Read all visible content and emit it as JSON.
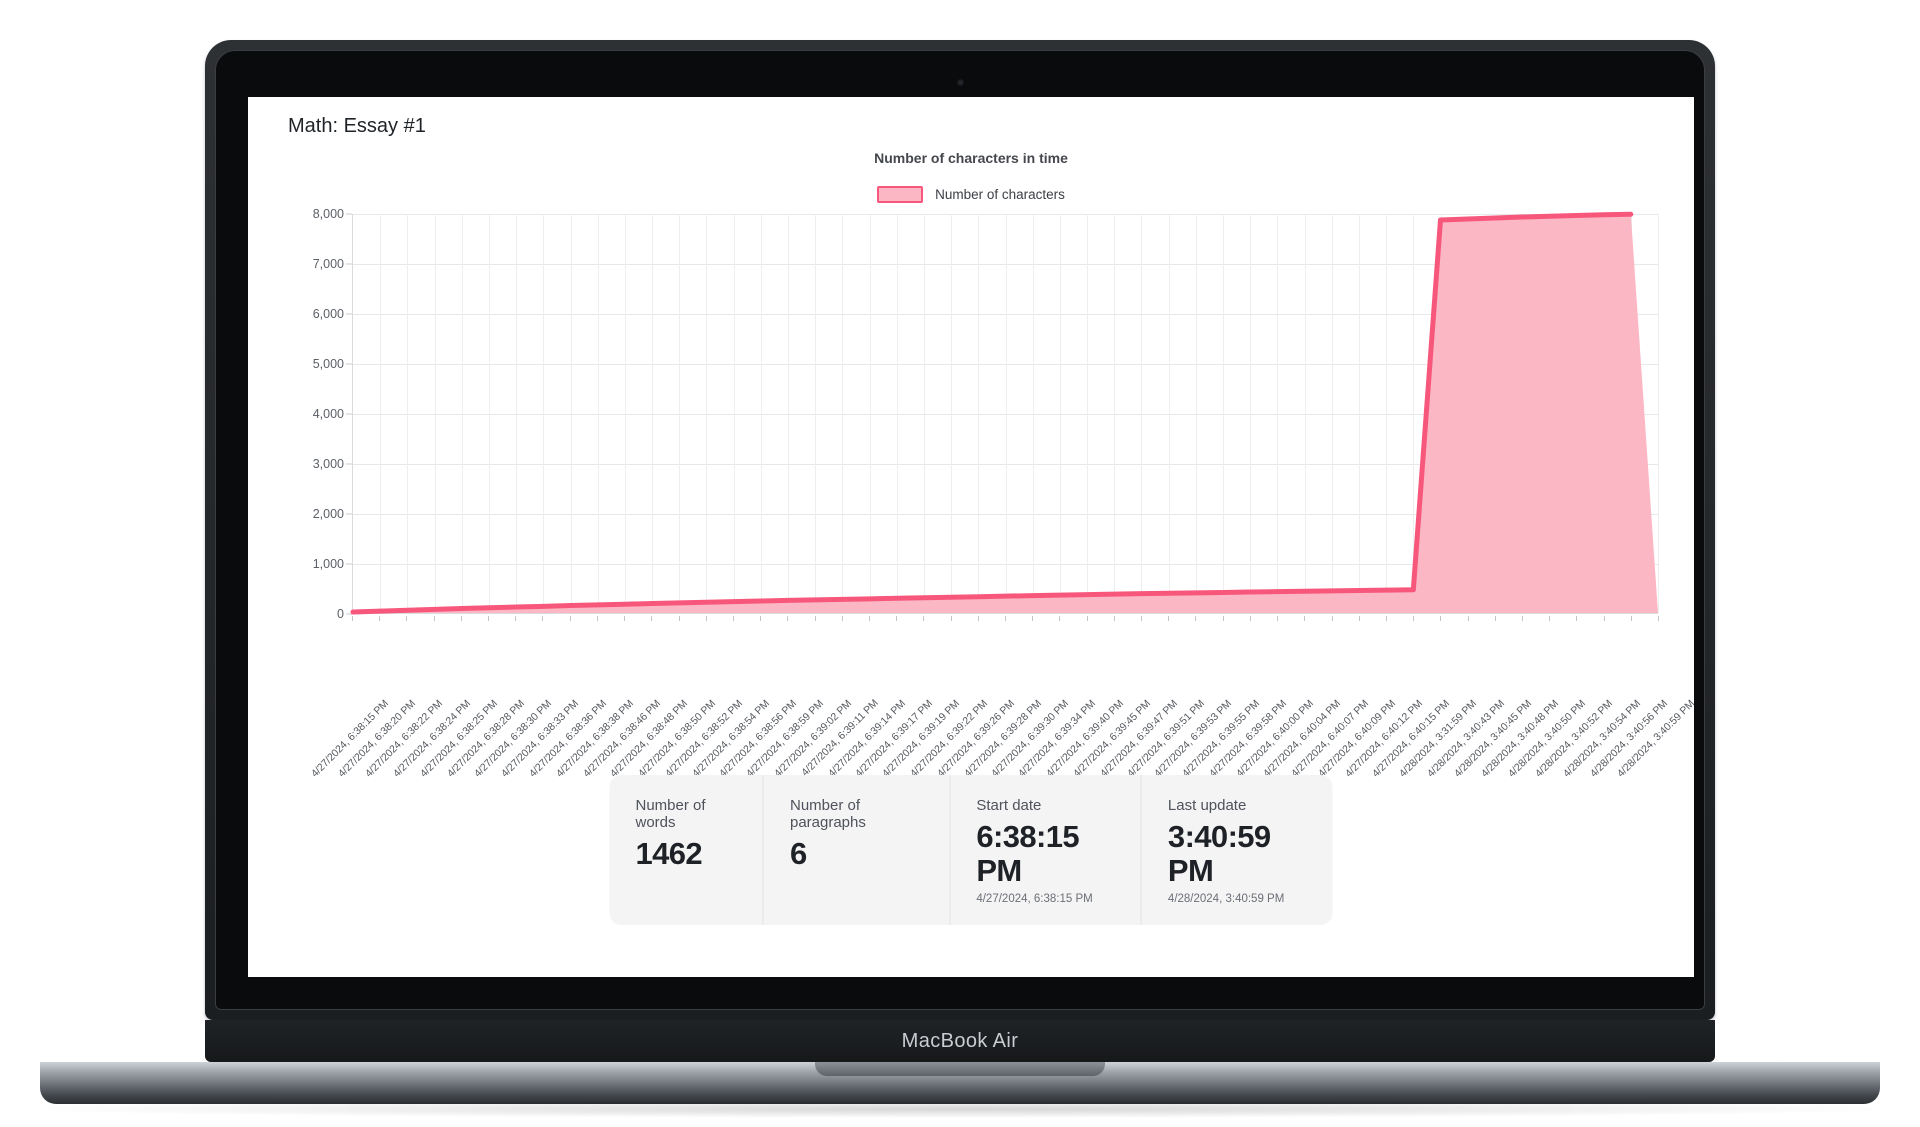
{
  "device": {
    "brand": "MacBook Air"
  },
  "page": {
    "title": "Math: Essay #1"
  },
  "chart_header": {
    "title": "Number of characters in time",
    "legend_label": "Number of characters",
    "line_color": "#f8577c",
    "fill_color": "#fbb7c4"
  },
  "stats": [
    {
      "label": "Number of words",
      "value": "1462",
      "sub": ""
    },
    {
      "label": "Number of paragraphs",
      "value": "6",
      "sub": ""
    },
    {
      "label": "Start date",
      "value": "6:38:15 PM",
      "sub": "4/27/2024, 6:38:15 PM"
    },
    {
      "label": "Last update",
      "value": "3:40:59 PM",
      "sub": "4/28/2024, 3:40:59 PM"
    }
  ],
  "chart_data": {
    "type": "area",
    "title": "Number of characters in time",
    "xlabel": "",
    "ylabel": "",
    "ylim": [
      0,
      8000
    ],
    "y_ticks": [
      "0",
      "1,000",
      "2,000",
      "3,000",
      "4,000",
      "5,000",
      "6,000",
      "7,000",
      "8,000"
    ],
    "grid": true,
    "legend_position": "top-center",
    "series": [
      {
        "name": "Number of characters",
        "line_color": "#f8577c",
        "fill_color": "#fbb7c4",
        "values": [
          20,
          38,
          55,
          72,
          90,
          105,
          120,
          134,
          150,
          162,
          176,
          190,
          204,
          216,
          228,
          240,
          252,
          263,
          274,
          284,
          295,
          306,
          316,
          327,
          338,
          348,
          358,
          368,
          378,
          388,
          396,
          404,
          412,
          420,
          428,
          436,
          443,
          450,
          458,
          465,
          7880,
          7900,
          7920,
          7940,
          7955,
          7970,
          7985,
          7995
        ]
      }
    ],
    "categories": [
      "4/27/2024, 6:38:15 PM",
      "4/27/2024, 6:38:20 PM",
      "4/27/2024, 6:38:22 PM",
      "4/27/2024, 6:38:24 PM",
      "4/27/2024, 6:38:25 PM",
      "4/27/2024, 6:38:28 PM",
      "4/27/2024, 6:38:30 PM",
      "4/27/2024, 6:38:33 PM",
      "4/27/2024, 6:38:36 PM",
      "4/27/2024, 6:38:38 PM",
      "4/27/2024, 6:38:46 PM",
      "4/27/2024, 6:38:48 PM",
      "4/27/2024, 6:38:50 PM",
      "4/27/2024, 6:38:52 PM",
      "4/27/2024, 6:38:54 PM",
      "4/27/2024, 6:38:56 PM",
      "4/27/2024, 6:38:59 PM",
      "4/27/2024, 6:39:02 PM",
      "4/27/2024, 6:39:11 PM",
      "4/27/2024, 6:39:14 PM",
      "4/27/2024, 6:39:17 PM",
      "4/27/2024, 6:39:19 PM",
      "4/27/2024, 6:39:22 PM",
      "4/27/2024, 6:39:26 PM",
      "4/27/2024, 6:39:28 PM",
      "4/27/2024, 6:39:30 PM",
      "4/27/2024, 6:39:34 PM",
      "4/27/2024, 6:39:40 PM",
      "4/27/2024, 6:39:45 PM",
      "4/27/2024, 6:39:47 PM",
      "4/27/2024, 6:39:51 PM",
      "4/27/2024, 6:39:53 PM",
      "4/27/2024, 6:39:55 PM",
      "4/27/2024, 6:39:58 PM",
      "4/27/2024, 6:40:00 PM",
      "4/27/2024, 6:40:04 PM",
      "4/27/2024, 6:40:07 PM",
      "4/27/2024, 6:40:09 PM",
      "4/27/2024, 6:40:12 PM",
      "4/27/2024, 6:40:15 PM",
      "4/28/2024, 3:31:59 PM",
      "4/28/2024, 3:40:43 PM",
      "4/28/2024, 3:40:45 PM",
      "4/28/2024, 3:40:48 PM",
      "4/28/2024, 3:40:50 PM",
      "4/28/2024, 3:40:52 PM",
      "4/28/2024, 3:40:54 PM",
      "4/28/2024, 3:40:56 PM",
      "4/28/2024, 3:40:59 PM"
    ]
  }
}
